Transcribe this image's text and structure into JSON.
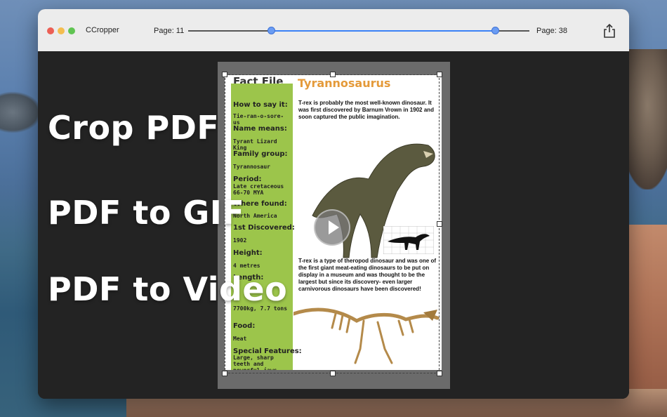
{
  "app": {
    "title": "CCropper"
  },
  "toolbar": {
    "start_page_label": "Page: 11",
    "end_page_label": "Page: 38",
    "range_start_page": 11,
    "range_end_page": 38,
    "share_icon": "share-icon"
  },
  "document": {
    "header_left": "Fact File",
    "header_right": "Tyrannosaurus",
    "fields": [
      {
        "label": "How to say it:",
        "value": "Tie-ran-o-sore-us"
      },
      {
        "label": "Name means:",
        "value": "Tyrant Lizard King"
      },
      {
        "label": "Family group:",
        "value": "Tyrannosaur"
      },
      {
        "label": "Period:",
        "value": "Late cretaceous 66-70 MYA"
      },
      {
        "label": "Where found:",
        "value": "North America"
      },
      {
        "label": "1st Discovered:",
        "value": "1902"
      },
      {
        "label": "Height:",
        "value": "4 metres"
      },
      {
        "label": "Length:",
        "value": ""
      },
      {
        "label": "",
        "value": "7700kg, 7.7 tons"
      },
      {
        "label": "Food:",
        "value": "Meat"
      },
      {
        "label": "Special Features:",
        "value": "Large, sharp teeth and powerful jaws"
      }
    ],
    "paragraph_1": "T-rex is probably the most well-known dinosaur. It was first discovered by Barnum Vrown in 1902 and soon captured the public imagination.",
    "paragraph_2": "T-rex is a type of theropod dinosaur and was one of the first giant meat-eating dinosaurs to be put on display in a museum and was thought to be the largest but since its discovery- even larger carnivorous dinosaurs have been discovered!"
  },
  "overlay": {
    "line_1": "Crop PDF",
    "line_2": "PDF to GIF",
    "line_3": "PDF to Video"
  },
  "colors": {
    "accent": "#3b82f6",
    "green_column": "#9cc54b",
    "header_orange": "#e49a3a"
  }
}
